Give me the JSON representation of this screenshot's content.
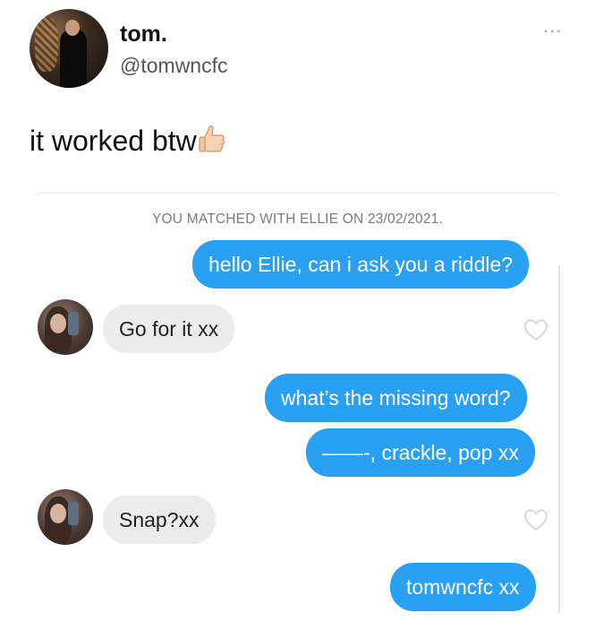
{
  "tweet": {
    "author_name": "tom.",
    "author_handle": "@tomwncfc",
    "more_label": "...",
    "text": "it worked btw",
    "emoji_icon": "thumbs-up-icon"
  },
  "chat": {
    "match_banner": "YOU MATCHED WITH ELLIE ON 23/02/2021.",
    "messages": [
      {
        "from": "me",
        "text": "hello Ellie, can i ask you a riddle?"
      },
      {
        "from": "ellie",
        "text": "Go for it xx"
      },
      {
        "from": "me",
        "text": "what’s the missing word?"
      },
      {
        "from": "me",
        "text": "——-, crackle, pop xx"
      },
      {
        "from": "ellie",
        "text": "Snap?xx"
      },
      {
        "from": "me",
        "text": "tomwncfc xx"
      }
    ]
  },
  "colors": {
    "outgoing_bubble": "#2aa0f2",
    "incoming_bubble": "#ececec",
    "heart_outline": "#d9d9d9"
  }
}
